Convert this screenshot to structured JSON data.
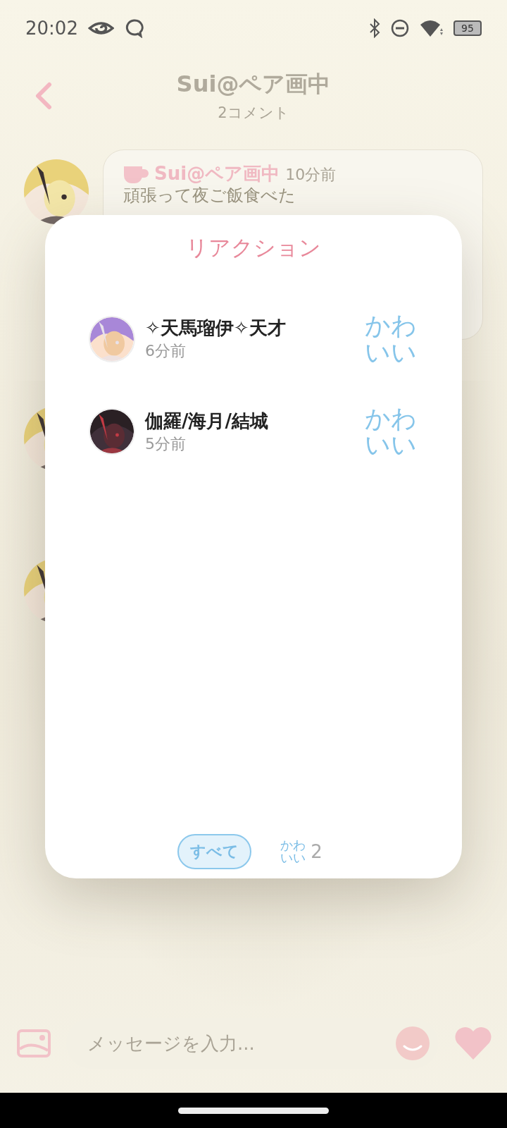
{
  "status_bar": {
    "time": "20:02",
    "battery": "95"
  },
  "header": {
    "title": "Sui@ペア画中",
    "subtitle": "2コメント"
  },
  "comments": [
    {
      "kind": "card",
      "author": "Sui@ペア画中",
      "time": "10分前",
      "text": "頑張って夜ご飯食べた"
    },
    {
      "kind": "avatar_only"
    },
    {
      "kind": "avatar_only"
    }
  ],
  "reaction_sheet": {
    "title": "リアクション",
    "reactions": [
      {
        "name": "✧天馬瑠伊✧天才",
        "time": "6分前",
        "reaction": "かわいい"
      },
      {
        "name": "伽羅/海月/結城",
        "time": "5分前",
        "reaction": "かわいい"
      }
    ],
    "tabs": [
      {
        "label": "すべて",
        "selected": true
      },
      {
        "label": "かわいい",
        "count": "2",
        "selected": false
      }
    ]
  },
  "composer": {
    "placeholder": "メッセージを入力..."
  }
}
